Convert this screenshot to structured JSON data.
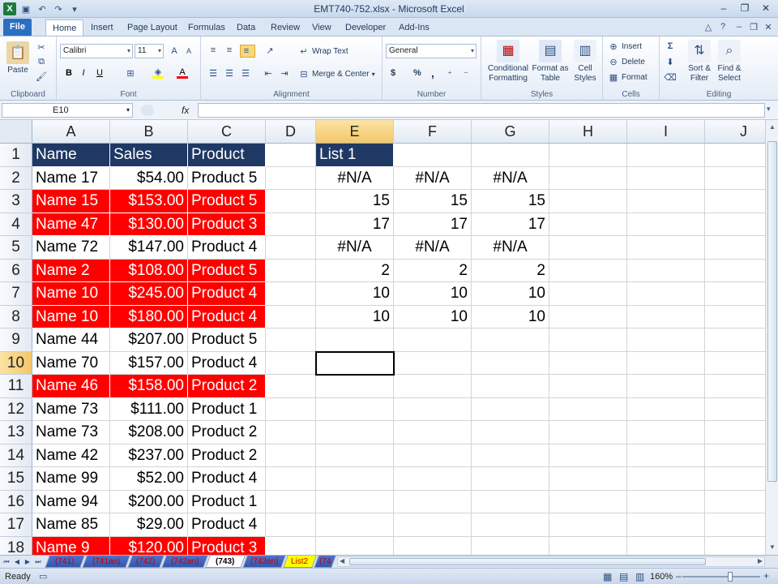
{
  "window": {
    "title": "EMT740-752.xlsx - Microsoft Excel"
  },
  "ribbon": {
    "tabs": [
      "File",
      "Home",
      "Insert",
      "Page Layout",
      "Formulas",
      "Data",
      "Review",
      "View",
      "Developer",
      "Add-Ins"
    ],
    "active_tab": "Home",
    "clipboard": {
      "paste": "Paste",
      "label": "Clipboard"
    },
    "font": {
      "name": "Calibri",
      "size": "11",
      "label": "Font"
    },
    "alignment": {
      "wrap": "Wrap Text",
      "merge": "Merge & Center",
      "label": "Alignment"
    },
    "number": {
      "format": "General",
      "currency": "$",
      "percent": "%",
      "comma": ",",
      "label": "Number"
    },
    "styles": {
      "conditional_1": "Conditional",
      "conditional_2": "Formatting",
      "format_table_1": "Format as",
      "format_table_2": "Table",
      "cell_styles_1": "Cell",
      "cell_styles_2": "Styles",
      "label": "Styles"
    },
    "cells": {
      "insert": "Insert",
      "delete": "Delete",
      "format": "Format",
      "label": "Cells"
    },
    "editing": {
      "sort_1": "Sort &",
      "sort_2": "Filter",
      "find_1": "Find &",
      "find_2": "Select",
      "label": "Editing"
    }
  },
  "formula_bar": {
    "name_box": "E10",
    "fx": "fx",
    "formula": ""
  },
  "grid": {
    "columns": [
      "A",
      "B",
      "C",
      "D",
      "E",
      "F",
      "G",
      "H",
      "I",
      "J"
    ],
    "selected_column": "E",
    "selected_row": 10,
    "rows": [
      {
        "n": "1",
        "a": "Name",
        "b": "Sales",
        "c": "Product",
        "e": "List 1",
        "f": "",
        "g": "",
        "style": "hdr"
      },
      {
        "n": "2",
        "a": "Name 17",
        "b": "$54.00",
        "c": "Product 5",
        "e": "#N/A",
        "f": "#N/A",
        "g": "#N/A",
        "style": "plain"
      },
      {
        "n": "3",
        "a": "Name 15",
        "b": "$153.00",
        "c": "Product 5",
        "e": "15",
        "f": "15",
        "g": "15",
        "style": "red"
      },
      {
        "n": "4",
        "a": "Name 47",
        "b": "$130.00",
        "c": "Product 3",
        "e": "17",
        "f": "17",
        "g": "17",
        "style": "red"
      },
      {
        "n": "5",
        "a": "Name 72",
        "b": "$147.00",
        "c": "Product 4",
        "e": "#N/A",
        "f": "#N/A",
        "g": "#N/A",
        "style": "plain"
      },
      {
        "n": "6",
        "a": "Name 2",
        "b": "$108.00",
        "c": "Product 5",
        "e": "2",
        "f": "2",
        "g": "2",
        "style": "red"
      },
      {
        "n": "7",
        "a": "Name 10",
        "b": "$245.00",
        "c": "Product 4",
        "e": "10",
        "f": "10",
        "g": "10",
        "style": "red"
      },
      {
        "n": "8",
        "a": "Name 10",
        "b": "$180.00",
        "c": "Product 4",
        "e": "10",
        "f": "10",
        "g": "10",
        "style": "red"
      },
      {
        "n": "9",
        "a": "Name 44",
        "b": "$207.00",
        "c": "Product 5",
        "e": "",
        "f": "",
        "g": "",
        "style": "plain"
      },
      {
        "n": "10",
        "a": "Name 70",
        "b": "$157.00",
        "c": "Product 4",
        "e": "",
        "f": "",
        "g": "",
        "style": "plain"
      },
      {
        "n": "11",
        "a": "Name 46",
        "b": "$158.00",
        "c": "Product 2",
        "e": "",
        "f": "",
        "g": "",
        "style": "red"
      },
      {
        "n": "12",
        "a": "Name 73",
        "b": "$111.00",
        "c": "Product 1",
        "e": "",
        "f": "",
        "g": "",
        "style": "plain"
      },
      {
        "n": "13",
        "a": "Name 73",
        "b": "$208.00",
        "c": "Product 2",
        "e": "",
        "f": "",
        "g": "",
        "style": "plain"
      },
      {
        "n": "14",
        "a": "Name 42",
        "b": "$237.00",
        "c": "Product 2",
        "e": "",
        "f": "",
        "g": "",
        "style": "plain"
      },
      {
        "n": "15",
        "a": "Name 99",
        "b": "$52.00",
        "c": "Product 4",
        "e": "",
        "f": "",
        "g": "",
        "style": "plain"
      },
      {
        "n": "16",
        "a": "Name 94",
        "b": "$200.00",
        "c": "Product 1",
        "e": "",
        "f": "",
        "g": "",
        "style": "plain"
      },
      {
        "n": "17",
        "a": "Name 85",
        "b": "$29.00",
        "c": "Product 4",
        "e": "",
        "f": "",
        "g": "",
        "style": "plain"
      },
      {
        "n": "18",
        "a": "Name 9",
        "b": "$120.00",
        "c": "Product 3",
        "e": "",
        "f": "",
        "g": "",
        "style": "red"
      }
    ]
  },
  "sheet_tabs": [
    {
      "label": "(741)",
      "style": "blue"
    },
    {
      "label": "(741an)",
      "style": "blue"
    },
    {
      "label": "(742)",
      "style": "blue"
    },
    {
      "label": "(742an)",
      "style": "blue"
    },
    {
      "label": "(743)",
      "style": "active"
    },
    {
      "label": "(743an)",
      "style": "blue"
    },
    {
      "label": "List2",
      "style": "yellow"
    },
    {
      "label": "(74",
      "style": "blue"
    }
  ],
  "status": {
    "ready": "Ready",
    "zoom": "160%"
  },
  "colors": {
    "header_fill": "#1f3864",
    "highlight_fill": "#ff0000",
    "selection_header": "#f4c76a"
  }
}
